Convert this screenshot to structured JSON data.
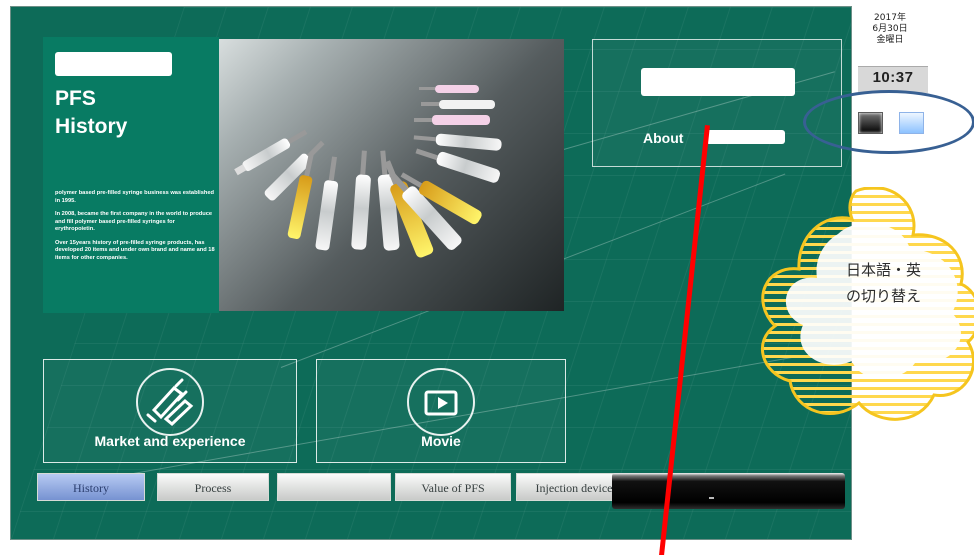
{
  "history_panel": {
    "title_line_1": "PFS",
    "title_line_2": "History",
    "paragraph_1": "polymer based pre-filled syringe business was established in 1995.",
    "paragraph_2": "In 2008, became the first company in the world to produce and fill polymer based pre-filled syringes for erythropoietin.",
    "paragraph_3": "Over 15years history of pre-filled syringe products, has developed 20 items and under own brand and name and 18 items for other companies."
  },
  "about_panel": {
    "label": "About"
  },
  "tiles": {
    "market_label": "Market and experience",
    "movie_label": "Movie"
  },
  "navigation": {
    "history": "History",
    "process": "Process",
    "value": "Value of PFS",
    "injection": "Injection device"
  },
  "clock": {
    "year": "2017年",
    "date": "6月30日",
    "weekday": "金曜日",
    "time": "10:37"
  },
  "annotation": {
    "line_1": "日本語・英",
    "line_2": "の切り替え"
  },
  "colors": {
    "main_green": "#0d6b58",
    "panel_green": "#087b63",
    "annotation_blue": "#386093",
    "annotation_red": "#ff0000",
    "cloud_yellow": "#ffd84d"
  }
}
